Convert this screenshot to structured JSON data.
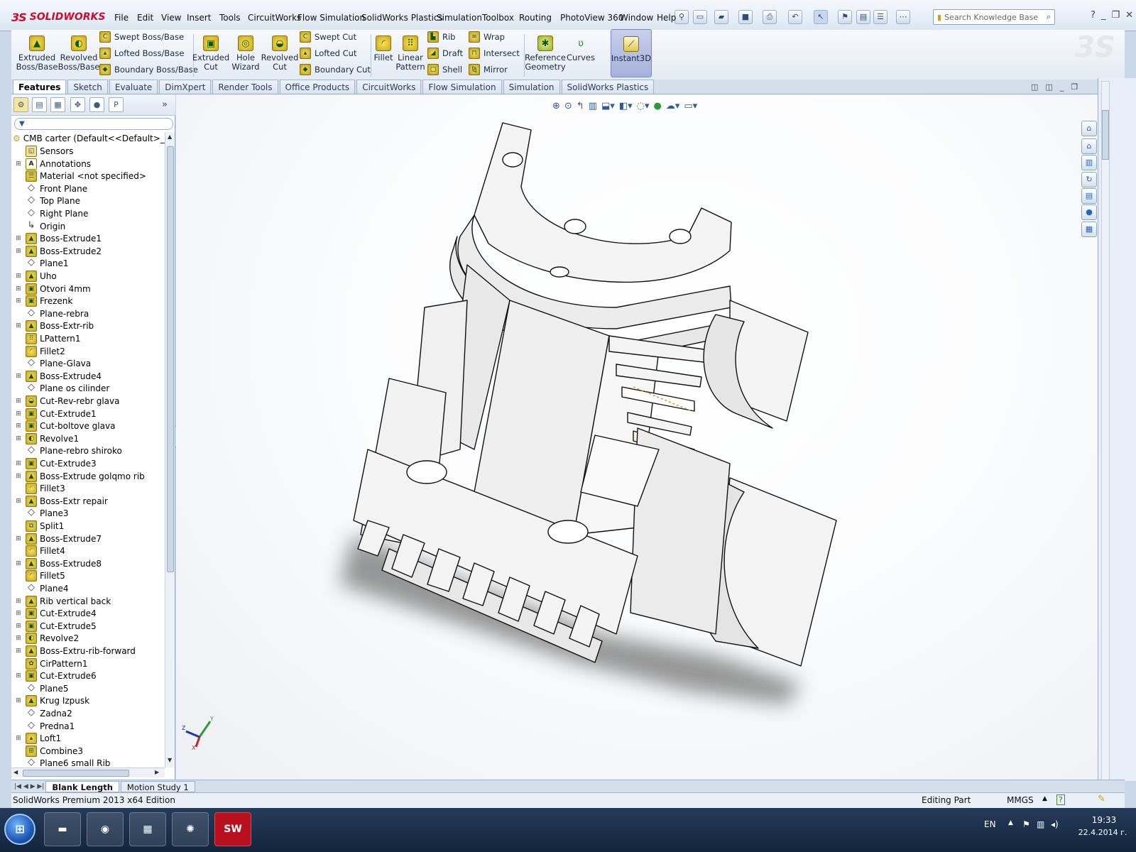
{
  "app": {
    "brand": "SOLIDWORKS",
    "brand_prefix": "3S"
  },
  "menu": [
    "File",
    "Edit",
    "View",
    "Insert",
    "Tools",
    "CircuitWorks",
    "Flow Simulation",
    "SolidWorks Plastics",
    "Simulation",
    "Toolbox",
    "Routing",
    "PhotoView 360",
    "Window",
    "Help"
  ],
  "search": {
    "placeholder": "Search Knowledge Base"
  },
  "commands": {
    "extruded_boss": "Extruded Boss/Base",
    "revolved_boss": "Revolved Boss/Base",
    "swept_boss": "Swept Boss/Base",
    "lofted_boss": "Lofted Boss/Base",
    "boundary_boss": "Boundary Boss/Base",
    "extruded_cut": "Extruded Cut",
    "hole_wizard": "Hole Wizard",
    "revolved_cut": "Revolved Cut",
    "swept_cut": "Swept Cut",
    "lofted_cut": "Lofted Cut",
    "boundary_cut": "Boundary Cut",
    "fillet": "Fillet",
    "linear_pattern": "Linear Pattern",
    "rib": "Rib",
    "draft": "Draft",
    "shell": "Shell",
    "wrap": "Wrap",
    "intersect": "Intersect",
    "mirror": "Mirror",
    "reference_geometry": "Reference Geometry",
    "curves": "Curves",
    "instant3d": "Instant3D"
  },
  "tabs": [
    "Features",
    "Sketch",
    "Evaluate",
    "DimXpert",
    "Render Tools",
    "Office Products",
    "CircuitWorks",
    "Flow Simulation",
    "Simulation",
    "SolidWorks Plastics"
  ],
  "active_tab": "Features",
  "tree": {
    "root": "CMB carter  (Default<<Default>_Disp",
    "items": [
      {
        "label": "Sensors",
        "icon": "sensor-icon",
        "expandable": false
      },
      {
        "label": "Annotations",
        "icon": "annotations-icon",
        "expandable": true
      },
      {
        "label": "Material <not specified>",
        "icon": "material-icon",
        "expandable": false
      },
      {
        "label": "Front Plane",
        "icon": "plane-icon",
        "expandable": false
      },
      {
        "label": "Top Plane",
        "icon": "plane-icon",
        "expandable": false
      },
      {
        "label": "Right Plane",
        "icon": "plane-icon",
        "expandable": false
      },
      {
        "label": "Origin",
        "icon": "origin-icon",
        "expandable": false
      },
      {
        "label": "Boss-Extrude1",
        "icon": "extrude-icon",
        "expandable": true
      },
      {
        "label": "Boss-Extrude2",
        "icon": "extrude-icon",
        "expandable": true
      },
      {
        "label": "Plane1",
        "icon": "plane-icon",
        "expandable": false
      },
      {
        "label": "Uho",
        "icon": "extrude-icon",
        "expandable": true
      },
      {
        "label": "Otvori 4mm",
        "icon": "cut-icon",
        "expandable": true
      },
      {
        "label": "Frezenk",
        "icon": "cut-icon",
        "expandable": true
      },
      {
        "label": "Plane-rebra",
        "icon": "plane-icon",
        "expandable": false
      },
      {
        "label": "Boss-Extr-rib",
        "icon": "extrude-icon",
        "expandable": true
      },
      {
        "label": "LPattern1",
        "icon": "pattern-icon",
        "expandable": false
      },
      {
        "label": "Fillet2",
        "icon": "fillet-icon",
        "expandable": false
      },
      {
        "label": "Plane-Glava",
        "icon": "plane-icon",
        "expandable": false
      },
      {
        "label": "Boss-Extrude4",
        "icon": "extrude-icon",
        "expandable": true
      },
      {
        "label": "Plane os cilinder",
        "icon": "plane-icon",
        "expandable": false
      },
      {
        "label": "Cut-Rev-rebr glava",
        "icon": "revcut-icon",
        "expandable": true
      },
      {
        "label": "Cut-Extrude1",
        "icon": "cut-icon",
        "expandable": true
      },
      {
        "label": "Cut-boltove glava",
        "icon": "cut-icon",
        "expandable": true
      },
      {
        "label": "Revolve1",
        "icon": "revolve-icon",
        "expandable": true
      },
      {
        "label": "Plane-rebro shiroko",
        "icon": "plane-icon",
        "expandable": false
      },
      {
        "label": "Cut-Extrude3",
        "icon": "cut-icon",
        "expandable": true
      },
      {
        "label": "Boss-Extrude golqmo rib",
        "icon": "extrude-icon",
        "expandable": true
      },
      {
        "label": "Fillet3",
        "icon": "fillet-icon",
        "expandable": false
      },
      {
        "label": "Boss-Extr repair",
        "icon": "extrude-icon",
        "expandable": true
      },
      {
        "label": "Plane3",
        "icon": "plane-icon",
        "expandable": false
      },
      {
        "label": "Split1",
        "icon": "split-icon",
        "expandable": false
      },
      {
        "label": "Boss-Extrude7",
        "icon": "extrude-icon",
        "expandable": true
      },
      {
        "label": "Fillet4",
        "icon": "fillet-icon",
        "expandable": false
      },
      {
        "label": "Boss-Extrude8",
        "icon": "extrude-icon",
        "expandable": true
      },
      {
        "label": "Fillet5",
        "icon": "fillet-icon",
        "expandable": false
      },
      {
        "label": "Plane4",
        "icon": "plane-icon",
        "expandable": false
      },
      {
        "label": "Rib vertical back",
        "icon": "extrude-icon",
        "expandable": true
      },
      {
        "label": "Cut-Extrude4",
        "icon": "cut-icon",
        "expandable": true
      },
      {
        "label": "Cut-Extrude5",
        "icon": "cut-icon",
        "expandable": true
      },
      {
        "label": "Revolve2",
        "icon": "revolve-icon",
        "expandable": true
      },
      {
        "label": "Boss-Extru-rib-forward",
        "icon": "extrude-icon",
        "expandable": true
      },
      {
        "label": "CirPattern1",
        "icon": "circpattern-icon",
        "expandable": false
      },
      {
        "label": "Cut-Extrude6",
        "icon": "cut-icon",
        "expandable": true
      },
      {
        "label": "Plane5",
        "icon": "plane-icon",
        "expandable": false
      },
      {
        "label": "Krug Izpusk",
        "icon": "extrude-icon",
        "expandable": true
      },
      {
        "label": "Zadna2",
        "icon": "plane-icon",
        "expandable": false
      },
      {
        "label": "Predna1",
        "icon": "plane-icon",
        "expandable": false
      },
      {
        "label": "Loft1",
        "icon": "loft-icon",
        "expandable": true
      },
      {
        "label": "Combine3",
        "icon": "combine-icon",
        "expandable": false
      },
      {
        "label": "Plane6 small Rib",
        "icon": "plane-icon",
        "expandable": false
      }
    ]
  },
  "bottom_tabs": [
    "Blank Length",
    "Motion Study 1"
  ],
  "status": {
    "left": "SolidWorks Premium 2013 x64 Edition",
    "mode": "Editing Part",
    "units": "MMGS"
  },
  "taskbar": {
    "lang": "EN",
    "time": "19:33",
    "date": "22.4.2014 г."
  },
  "colors": {
    "accent": "#c8102e",
    "feature_yellow": "#f2d64a",
    "model_fill": "#f4f4f4"
  }
}
